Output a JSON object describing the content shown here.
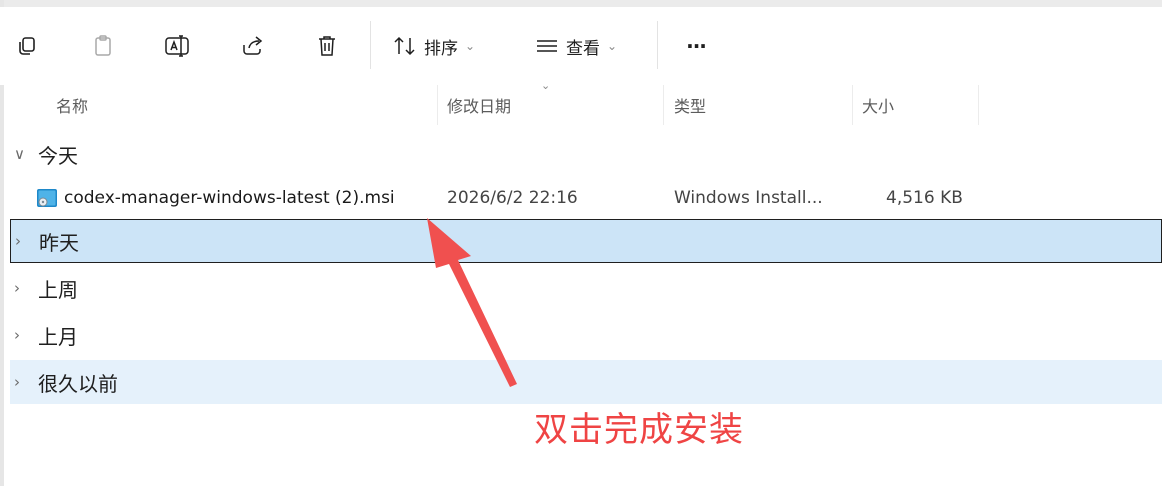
{
  "toolbar": {
    "sort_label": "排序",
    "view_label": "查看",
    "more_label": "···"
  },
  "columns": {
    "name": "名称",
    "modified": "修改日期",
    "type": "类型",
    "size": "大小"
  },
  "groups": [
    {
      "label": "今天",
      "expanded": true
    },
    {
      "label": "昨天",
      "expanded": false,
      "selected": true
    },
    {
      "label": "上周",
      "expanded": false
    },
    {
      "label": "上月",
      "expanded": false
    },
    {
      "label": "很久以前",
      "expanded": false,
      "hover": true
    }
  ],
  "file": {
    "name": "codex-manager-windows-latest (2).msi",
    "modified": "2026/6/2 22:16",
    "type": "Windows Install...",
    "size": "4,516 KB"
  },
  "annotation": {
    "text": "双击完成安装",
    "color": "#ef4444"
  },
  "colors": {
    "selection": "#cce4f7",
    "hover": "#e5f1fb"
  }
}
